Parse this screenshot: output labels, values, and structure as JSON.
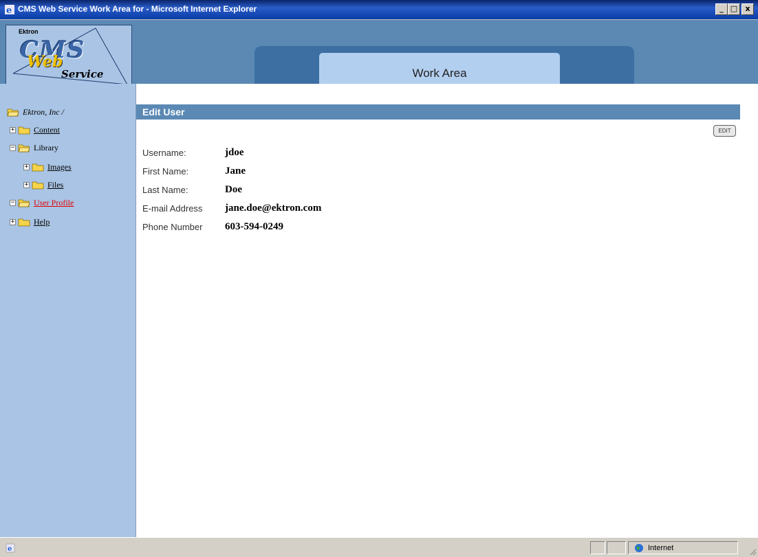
{
  "window": {
    "title": "CMS Web Service Work Area for - Microsoft Internet Explorer",
    "minimize": "_",
    "maximize": "□",
    "close": "x"
  },
  "header": {
    "logo_company": "Ektron",
    "logo_cms": "CMS",
    "logo_web": "Web",
    "logo_service": "Service",
    "banner": "Work Area"
  },
  "tree": {
    "root": "Ektron, Inc /",
    "items": [
      {
        "label": "Content",
        "expander": "+"
      },
      {
        "label": "Library",
        "expander": "−"
      },
      {
        "label": "Images",
        "expander": "+"
      },
      {
        "label": "Files",
        "expander": "+"
      },
      {
        "label": "User Profile",
        "expander": "−"
      },
      {
        "label": "Help",
        "expander": "+"
      }
    ]
  },
  "main": {
    "section_title": "Edit User",
    "edit_button": "EDIT",
    "fields": [
      {
        "label": "Username:",
        "value": "jdoe"
      },
      {
        "label": "First Name:",
        "value": "Jane"
      },
      {
        "label": "Last Name:",
        "value": "Doe"
      },
      {
        "label": "E-mail Address",
        "value": "jane.doe@ektron.com"
      },
      {
        "label": "Phone Number",
        "value": "603-594-0249"
      }
    ]
  },
  "statusbar": {
    "zone": "Internet"
  },
  "colors": {
    "header_bg": "#5b89b4",
    "sidebar_bg": "#a9c4e4",
    "banner_inner": "#b3cff0",
    "active_link": "#e00000"
  }
}
